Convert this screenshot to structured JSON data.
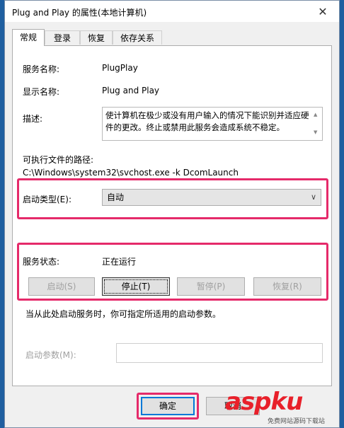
{
  "window": {
    "title": "Plug and Play 的属性(本地计算机)",
    "close_glyph": "✕"
  },
  "tabs": [
    {
      "label": "常规",
      "active": true
    },
    {
      "label": "登录",
      "active": false
    },
    {
      "label": "恢复",
      "active": false
    },
    {
      "label": "依存关系",
      "active": false
    }
  ],
  "general": {
    "service_name_label": "服务名称:",
    "service_name_value": "PlugPlay",
    "display_name_label": "显示名称:",
    "display_name_value": "Plug and Play",
    "description_label": "描述:",
    "description_value": "使计算机在极少或没有用户输入的情况下能识别并适应硬件的更改。终止或禁用此服务会造成系统不稳定。",
    "exe_path_label": "可执行文件的路径:",
    "exe_path_value": "C:\\Windows\\system32\\svchost.exe -k DcomLaunch",
    "startup_type_label": "启动类型(E):",
    "startup_type_value": "自动",
    "service_status_label": "服务状态:",
    "service_status_value": "正在运行",
    "buttons": {
      "start": "启动(S)",
      "stop": "停止(T)",
      "pause": "暂停(P)",
      "resume": "恢复(R)"
    },
    "hint": "当从此处启动服务时，你可指定所适用的启动参数。",
    "start_params_label": "启动参数(M):",
    "start_params_value": ""
  },
  "footer": {
    "ok": "确定",
    "cancel": "取消"
  },
  "watermark": {
    "main": "aspku",
    "sub": "免费网站源码下载站"
  },
  "colors": {
    "highlight": "#e52a6a",
    "watermark": "#e8202a",
    "focus": "#0078d7"
  }
}
